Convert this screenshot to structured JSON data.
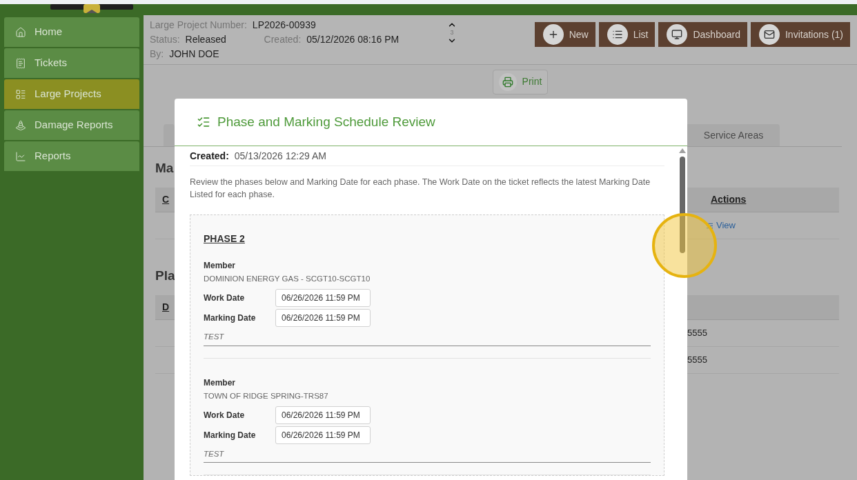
{
  "sidebar": {
    "items": [
      {
        "label": "Home",
        "selected": false
      },
      {
        "label": "Tickets",
        "selected": false
      },
      {
        "label": "Large Projects",
        "selected": true
      },
      {
        "label": "Damage Reports",
        "selected": false
      },
      {
        "label": "Reports",
        "selected": false
      }
    ]
  },
  "project": {
    "number_label": "Large Project Number:",
    "number": "LP2026-00939",
    "status_label": "Status:",
    "status": "Released",
    "created_label": "Created:",
    "created": "05/12/2026 08:16 PM",
    "by_label": "By:",
    "by": "JOHN DOE"
  },
  "pager": {
    "count": "3"
  },
  "actions": [
    {
      "label": "New"
    },
    {
      "label": "List"
    },
    {
      "label": "Dashboard"
    },
    {
      "label": "Invitations (1)"
    }
  ],
  "print_button": {
    "label": "Print"
  },
  "background": {
    "tab": "Service Areas",
    "sections": [
      {
        "heading": "Ma",
        "column": "C",
        "actions_header": "Actions",
        "rows": [
          {
            "link": "View"
          }
        ]
      },
      {
        "heading": "Pla",
        "column": "D",
        "rows": [
          {
            "cell": "5555"
          },
          {
            "cell": "5555"
          }
        ]
      }
    ]
  },
  "modal": {
    "title": "Phase and Marking Schedule Review",
    "created_label": "Created:",
    "created": "05/13/2026 12:29 AM",
    "intro": "Review the phases below and Marking Date for each phase. The Work Date on the ticket reflects the latest Marking Date Listed for each phase.",
    "phases": [
      {
        "title": "PHASE 2",
        "members": [
          {
            "member_label": "Member",
            "member": "DOMINION ENERGY GAS - SCGT10-SCGT10",
            "work_date_label": "Work Date",
            "work_date": "06/26/2026 11:59 PM",
            "marking_date_label": "Marking Date",
            "marking_date": "06/26/2026 11:59 PM",
            "note": "TEST"
          },
          {
            "member_label": "Member",
            "member": "TOWN OF RIDGE SPRING-TRS87",
            "work_date_label": "Work Date",
            "work_date": "06/26/2026 11:59 PM",
            "marking_date_label": "Marking Date",
            "marking_date": "06/26/2026 11:59 PM",
            "note": "TEST"
          }
        ]
      }
    ]
  }
}
